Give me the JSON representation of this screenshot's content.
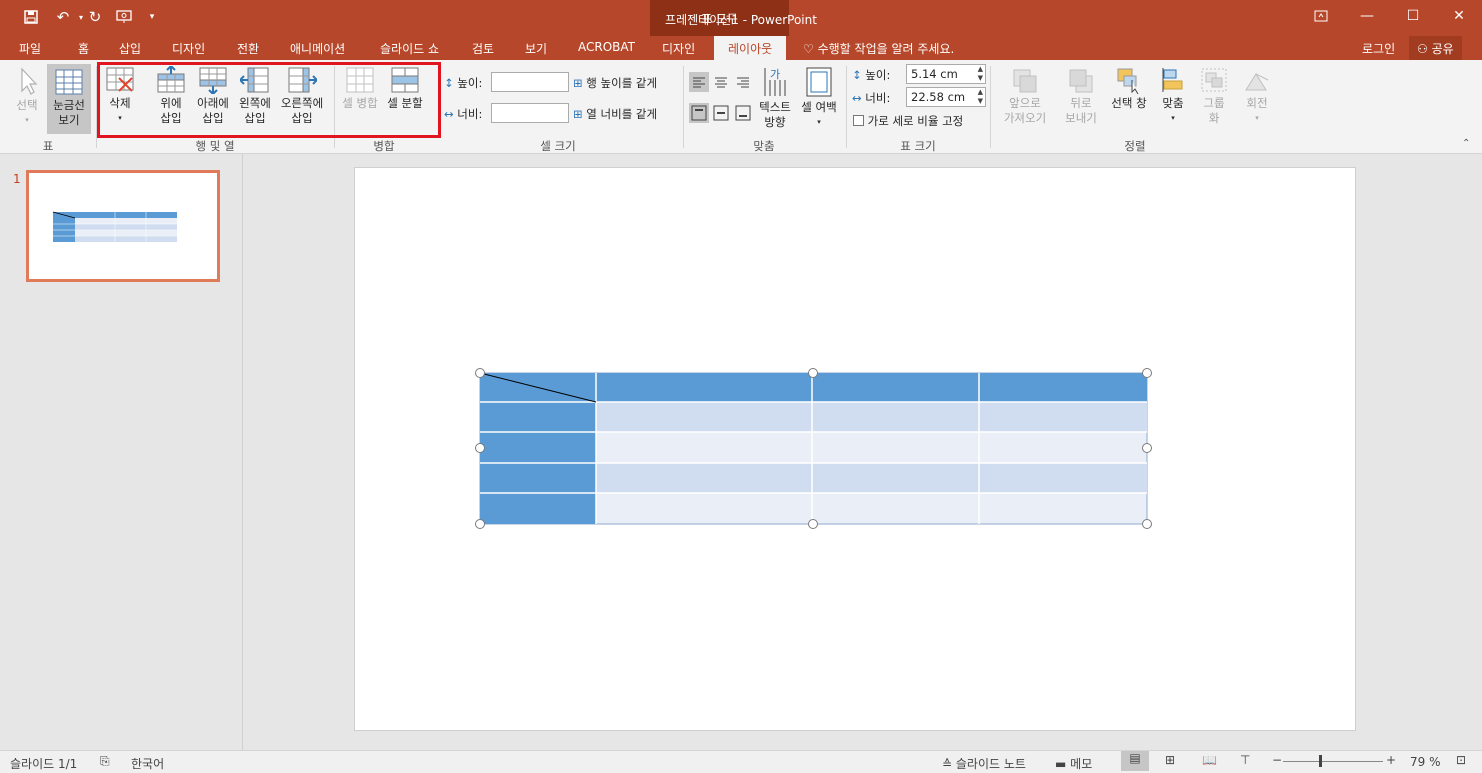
{
  "window": {
    "title": "프레젠테이션1 - PowerPoint",
    "context_group": "표 도구"
  },
  "tabs": [
    "파일",
    "홈",
    "삽입",
    "디자인",
    "전환",
    "애니메이션",
    "슬라이드 쇼",
    "검토",
    "보기",
    "ACROBAT",
    "디자인",
    "레이아웃"
  ],
  "active_tab": "레이아웃",
  "tell_me": "수행할 작업을 알려 주세요.",
  "account": {
    "login": "로그인",
    "share": "공유"
  },
  "ribbon": {
    "table_group": {
      "label": "표",
      "select": "선택",
      "gridlines_line1": "눈금선",
      "gridlines_line2": "보기"
    },
    "rows_cols_group": {
      "label": "행 및 열",
      "delete": "삭제",
      "insert_above_1": "위에",
      "insert_above_2": "삽입",
      "insert_below_1": "아래에",
      "insert_below_2": "삽입",
      "insert_left_1": "왼쪽에",
      "insert_left_2": "삽입",
      "insert_right_1": "오른쪽에",
      "insert_right_2": "삽입"
    },
    "merge_group": {
      "label": "병합",
      "merge_cells": "셀 병합",
      "split_cells": "셀 분할"
    },
    "cell_size_group": {
      "label": "셀 크기",
      "height_label": "높이:",
      "width_label": "너비:",
      "height_value": "",
      "width_value": "",
      "distribute_rows": "행 높이를 같게",
      "distribute_cols": "열 너비를 같게"
    },
    "alignment_group": {
      "label": "맞춤",
      "text_direction_1": "텍스트",
      "text_direction_2": "방향",
      "cell_margins": "셀 여백"
    },
    "table_size_group": {
      "label": "표 크기",
      "height_label": "높이:",
      "width_label": "너비:",
      "height_value": "5.14 cm",
      "width_value": "22.58 cm",
      "lock_aspect": "가로 세로 비율 고정"
    },
    "arrange_group": {
      "label": "정렬",
      "bring_forward_1": "앞으로",
      "bring_forward_2": "가져오기",
      "send_backward_1": "뒤로",
      "send_backward_2": "보내기",
      "selection_pane": "선택 창",
      "align": "맞춤",
      "group_1": "그룹",
      "group_2": "화",
      "rotate": "회전"
    }
  },
  "slides": {
    "current_number": "1"
  },
  "table": {
    "rows": 5,
    "cols": 4,
    "colors": {
      "header": "#5b9bd5",
      "band_dark": "#d0dcef",
      "band_light": "#e9eef7"
    }
  },
  "status": {
    "slide_info": "슬라이드 1/1",
    "language": "한국어",
    "notes": "슬라이드 노트",
    "comments": "메모",
    "zoom": "79 %"
  },
  "colors": {
    "accent": "#b7472a",
    "context": "#8e3015",
    "highlight": "#e0151f"
  }
}
